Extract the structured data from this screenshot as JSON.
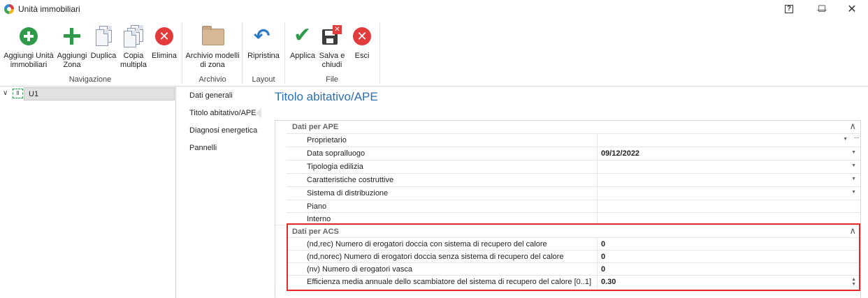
{
  "window": {
    "title": "Unità immobiliari",
    "help_glyph": "?",
    "minimize_glyph": "—",
    "maximize_glyph": "☐",
    "close_glyph": "✕"
  },
  "ribbon": {
    "groups": {
      "navigazione": "Navigazione",
      "archivio": "Archivio",
      "layout": "Layout",
      "file": "File"
    },
    "buttons": {
      "aggiungi_unita": "Aggiungi Unità immobiliari",
      "aggiungi_zona": "Aggiungi Zona",
      "duplica": "Duplica",
      "copia_multipla": "Copia multipla",
      "elimina": "Elimina",
      "archivio_modelli": "Archivio modelli di zona",
      "ripristina": "Ripristina",
      "applica": "Applica",
      "salva_chiudi": "Salva e chiudi",
      "esci": "Esci"
    },
    "icons": {
      "aggiungi_unita": "add-circle-icon",
      "aggiungi_zona": "plus-icon",
      "duplica": "copy-icon",
      "copia_multipla": "copy-multiple-icon",
      "elimina": "delete-icon",
      "archivio_modelli": "folder-icon",
      "ripristina": "undo-icon",
      "applica": "check-icon",
      "salva_chiudi": "save-close-icon",
      "esci": "exit-icon"
    }
  },
  "tree": {
    "items": [
      {
        "label": "U1",
        "expanded": true,
        "selected": true,
        "icon_text": "II"
      }
    ]
  },
  "nav": {
    "items": [
      {
        "label": "Dati generali"
      },
      {
        "label": "Titolo abitativo/APE",
        "active": true
      },
      {
        "label": "Diagnosi energetica"
      },
      {
        "label": "Pannelli"
      }
    ]
  },
  "main": {
    "title": "Titolo abitativo/APE",
    "categories": [
      {
        "label": "Dati per APE",
        "rows": [
          {
            "name": "Proprietario",
            "value": "",
            "control": "dropdown-ellipsis"
          },
          {
            "name": "Data sopralluogo",
            "value": "09/12/2022",
            "control": "dropdown"
          },
          {
            "name": "Tipologia edilizia",
            "value": "",
            "control": "dropdown"
          },
          {
            "name": "Caratteristiche costruttive",
            "value": "",
            "control": "dropdown"
          },
          {
            "name": "Sistema di distribuzione",
            "value": "",
            "control": "dropdown"
          },
          {
            "name": "Piano",
            "value": "",
            "control": "text"
          },
          {
            "name": "Interno",
            "value": "",
            "control": "text"
          }
        ]
      },
      {
        "label": "Dati per ACS",
        "highlighted": true,
        "highlight_color": "#e32b2b",
        "rows": [
          {
            "name": "(nd,rec) Numero di erogatori doccia con sistema di recupero del calore",
            "value": "0",
            "control": "text"
          },
          {
            "name": "(nd,norec) Numero di erogatori doccia senza sistema di recupero del calore",
            "value": "0",
            "control": "text"
          },
          {
            "name": "(nv) Numero di erogatori vasca",
            "value": "0",
            "control": "text"
          },
          {
            "name": "Efficienza media annuale dello scambiatore del sistema di recupero del calore [0..1]",
            "value": "0.30",
            "control": "spin"
          }
        ]
      }
    ]
  },
  "colors": {
    "accent_title": "#2b6fb3",
    "green": "#2e9a4a",
    "red": "#e23b3b",
    "blue": "#2b78c6"
  }
}
